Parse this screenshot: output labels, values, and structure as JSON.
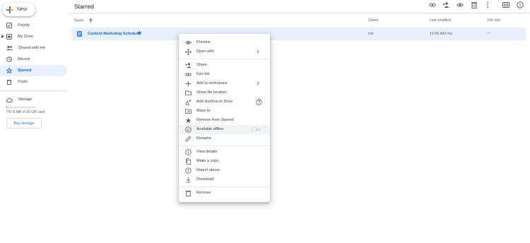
{
  "app": {
    "new_label": "New",
    "colors": {
      "accent": "#1a73e8",
      "selected_bg": "#e8f0fe",
      "selected_text": "#1967d2",
      "star": "#1a73e8"
    }
  },
  "sidebar": {
    "items": [
      {
        "label": "Priority",
        "icon": "check-circle-icon"
      },
      {
        "label": "My Drive",
        "icon": "my-drive-icon"
      },
      {
        "label": "Shared with me",
        "icon": "shared-people-icon"
      },
      {
        "label": "Recent",
        "icon": "clock-icon"
      },
      {
        "label": "Starred",
        "icon": "star-icon",
        "active": true
      },
      {
        "label": "Trash",
        "icon": "trash-icon"
      }
    ],
    "storage": {
      "label": "Storage",
      "usage_text": "747.6 MB of 30 GB used",
      "used_fraction": 0.025,
      "buy_label": "Buy storage"
    }
  },
  "header": {
    "title": "Starred",
    "toolbar_icons": [
      "link-icon",
      "add-person-icon",
      "preview-eye-icon",
      "trash-icon",
      "more-vert-icon",
      "grid-view-icon",
      "info-icon"
    ]
  },
  "table": {
    "columns": {
      "name": "Name",
      "owner": "Owner",
      "modified": "Last modified",
      "size": "File size"
    },
    "rows": [
      {
        "name": "Content Marketing Schedule",
        "owner": "me",
        "modified": "11:56 AM  me",
        "size": "—",
        "icon": "document-icon",
        "starred": true
      }
    ]
  },
  "context_menu": {
    "items": [
      {
        "label": "Preview",
        "icon": "eye-icon"
      },
      {
        "label": "Open with",
        "icon": "open-with-icon",
        "submenu": true
      },
      {
        "label": "Share",
        "icon": "add-person-icon"
      },
      {
        "label": "Get link",
        "icon": "link-icon"
      },
      {
        "label": "Add to workspace",
        "icon": "plus-icon",
        "submenu": true
      },
      {
        "label": "Show file location",
        "icon": "folder-icon"
      },
      {
        "label": "Add shortcut to Drive",
        "icon": "add-shortcut-icon",
        "help": true
      },
      {
        "label": "Move to",
        "icon": "move-to-folder-icon"
      },
      {
        "label": "Remove from Starred",
        "icon": "star-icon"
      },
      {
        "label": "Available offline",
        "icon": "offline-check-icon",
        "toggle": false
      },
      {
        "label": "Rename",
        "icon": "pencil-icon"
      },
      {
        "label": "View details",
        "icon": "info-icon"
      },
      {
        "label": "Make a copy",
        "icon": "copy-icon"
      },
      {
        "label": "Report abuse",
        "icon": "report-icon"
      },
      {
        "label": "Download",
        "icon": "download-icon"
      },
      {
        "label": "Remove",
        "icon": "trash-icon"
      }
    ]
  }
}
